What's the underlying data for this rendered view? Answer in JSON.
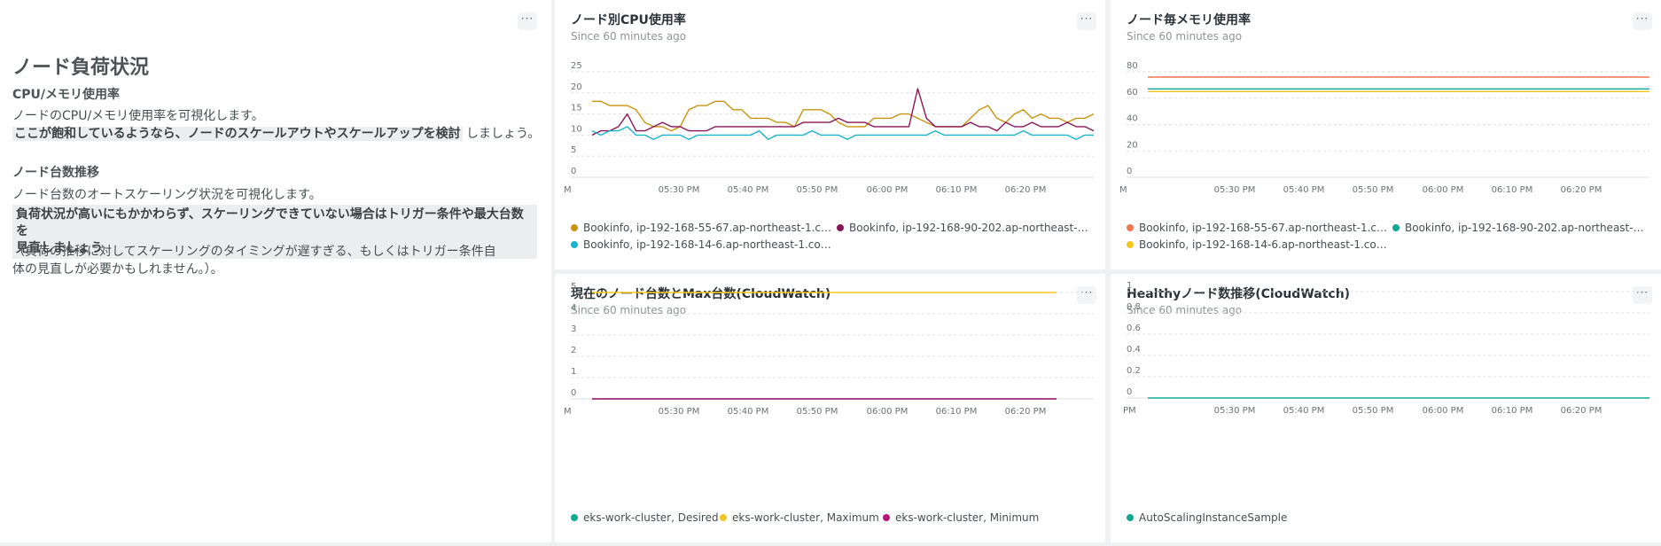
{
  "markdown": {
    "heading": "ノード負荷状況",
    "sections": [
      {
        "subheading": "CPU/メモリ使用率",
        "line1": "ノードのCPU/メモリ使用率を可視化します。",
        "highlight": "ここが飽和しているようなら、ノードのスケールアウトやスケールアップを検討",
        "tail": " しましょう。"
      },
      {
        "subheading": "ノード台数推移",
        "line1": "ノード台数のオートスケーリング状況を可視化します。",
        "highlight_l1": "負荷状況が高いにもかかわらず、スケーリングできていない場合はトリガー条件や最大台数を",
        "highlight_l2": "見直しましょう",
        "note_l1": "（負荷の推移に対してスケーリングのタイミングが遅すぎる、もしくはトリガー条件自",
        "note_l2": "体の見直しが必要かもしれません。）。"
      }
    ],
    "menu": "···"
  },
  "widgets": [
    {
      "title": "ノード別CPU使用率",
      "since": "Since 60 minutes ago",
      "menu": "···",
      "legend": [
        {
          "label": "Bookinfo, ip-192-168-55-67.ap-northeast-1.co...",
          "color": "#c9920f"
        },
        {
          "label": "Bookinfo, ip-192-168-90-202.ap-northeast-1.c...",
          "color": "#8a1457"
        },
        {
          "label": "Bookinfo, ip-192-168-14-6.ap-northeast-1.com...",
          "color": "#18b3cc"
        }
      ]
    },
    {
      "title": "ノード毎メモリ使用率",
      "since": "Since 60 minutes ago",
      "menu": "···",
      "legend": [
        {
          "label": "Bookinfo, ip-192-168-55-67.ap-northeast-1.co...",
          "color": "#f3754f"
        },
        {
          "label": "Bookinfo, ip-192-168-90-202.ap-northeast-1.c...",
          "color": "#11a893"
        },
        {
          "label": "Bookinfo, ip-192-168-14-6.ap-northeast-1.com...",
          "color": "#f5c51f"
        }
      ]
    },
    {
      "title": "現在のノード台数とMax台数(CloudWatch)",
      "since": "Since 60 minutes ago",
      "menu": "···",
      "legend": [
        {
          "label": "eks-work-cluster, Desired",
          "color": "#11a893"
        },
        {
          "label": "eks-work-cluster, Maximum",
          "color": "#f5c51f"
        },
        {
          "label": "eks-work-cluster, Minimum",
          "color": "#b5167a"
        }
      ]
    },
    {
      "title": "Healthyノード数推移(CloudWatch)",
      "since": "Since 60 minutes ago",
      "menu": "···",
      "legend": [
        {
          "label": "AutoScalingInstanceSample",
          "color": "#11a893"
        }
      ]
    }
  ],
  "chart_data": [
    {
      "type": "line",
      "title": "ノード別CPU使用率",
      "x_ticks": [
        "M",
        "05:30 PM",
        "05:40 PM",
        "05:50 PM",
        "06:00 PM",
        "06:10 PM",
        "06:20 PM"
      ],
      "y_ticks": [
        "0",
        "5",
        "10",
        "15",
        "20",
        "25"
      ],
      "ylim": [
        0,
        25
      ],
      "x_points": 58,
      "series": [
        {
          "name": "Bookinfo, ip-192-168-55-67.ap-northeast-1.co...",
          "color": "#c9920f",
          "values": [
            18,
            18,
            17,
            17,
            17,
            16,
            13,
            12,
            12,
            11,
            12,
            16,
            17,
            17,
            18,
            18,
            16,
            16,
            14,
            14,
            14,
            13,
            13,
            12,
            16,
            16,
            16,
            15,
            13,
            12,
            12,
            12,
            14,
            14,
            14,
            15,
            15,
            14,
            13,
            12,
            12,
            12,
            12,
            14,
            16,
            17,
            14,
            13,
            15,
            16,
            14,
            15,
            14,
            14,
            13,
            14,
            14,
            15
          ]
        },
        {
          "name": "Bookinfo, ip-192-168-90-202.ap-northeast-1.c...",
          "color": "#8a1457",
          "values": [
            10,
            11,
            11,
            12,
            15,
            11,
            11,
            12,
            13,
            12,
            12,
            11,
            11,
            11,
            12,
            12,
            12,
            12,
            12,
            12,
            12,
            12,
            12,
            12,
            13,
            13,
            13,
            13,
            14,
            13,
            13,
            13,
            12,
            12,
            12,
            12,
            12,
            21,
            14,
            12,
            12,
            12,
            12,
            13,
            12,
            12,
            11,
            13,
            12,
            12,
            13,
            12,
            12,
            12,
            13,
            12,
            12,
            11
          ]
        },
        {
          "name": "Bookinfo, ip-192-168-14-6.ap-northeast-1.com...",
          "color": "#18b3cc",
          "values": [
            11,
            10,
            11,
            11,
            12,
            10,
            10,
            9,
            10,
            10,
            10,
            9,
            10,
            10,
            10,
            10,
            10,
            10,
            10,
            11,
            9,
            10,
            10,
            10,
            10,
            11,
            10,
            10,
            10,
            9,
            10,
            10,
            10,
            10,
            10,
            10,
            10,
            10,
            10,
            11,
            10,
            10,
            10,
            10,
            10,
            10,
            10,
            10,
            10,
            11,
            10,
            10,
            10,
            10,
            10,
            9,
            10,
            10
          ]
        }
      ]
    },
    {
      "type": "line",
      "title": "ノード毎メモリ使用率",
      "x_ticks": [
        "M",
        "05:30 PM",
        "05:40 PM",
        "05:50 PM",
        "06:00 PM",
        "06:10 PM",
        "06:20 PM"
      ],
      "y_ticks": [
        "0",
        "20",
        "40",
        "60",
        "80"
      ],
      "ylim": [
        0,
        80
      ],
      "x_points": 2,
      "series": [
        {
          "name": "Bookinfo, ip-192-168-55-67.ap-northeast-1.co...",
          "color": "#f3754f",
          "values": [
            76,
            76
          ]
        },
        {
          "name": "Bookinfo, ip-192-168-90-202.ap-northeast-1.c...",
          "color": "#11a893",
          "values": [
            67,
            67
          ]
        },
        {
          "name": "Bookinfo, ip-192-168-14-6.ap-northeast-1.com...",
          "color": "#f5c51f",
          "values": [
            65,
            65
          ]
        }
      ]
    },
    {
      "type": "line",
      "title": "現在のノード台数とMax台数(CloudWatch)",
      "x_ticks": [
        "M",
        "05:30 PM",
        "05:40 PM",
        "05:50 PM",
        "06:00 PM",
        "06:10 PM",
        "06:20 PM"
      ],
      "y_ticks": [
        "0",
        "1",
        "2",
        "3",
        "4",
        "5"
      ],
      "ylim": [
        0,
        5
      ],
      "x_points": 2,
      "series": [
        {
          "name": "eks-work-cluster, Desired",
          "color": "#11a893",
          "values": [
            0,
            0
          ]
        },
        {
          "name": "eks-work-cluster, Maximum",
          "color": "#f5c51f",
          "values": [
            5,
            5
          ]
        },
        {
          "name": "eks-work-cluster, Minimum",
          "color": "#b5167a",
          "values": [
            0,
            0
          ]
        }
      ]
    },
    {
      "type": "line",
      "title": "Healthyノード数推移(CloudWatch)",
      "x_ticks": [
        "PM",
        "05:30 PM",
        "05:40 PM",
        "05:50 PM",
        "06:00 PM",
        "06:10 PM",
        "06:20 PM"
      ],
      "y_ticks": [
        "0",
        "0.2",
        "0.4",
        "0.6",
        "0.8",
        "1"
      ],
      "ylim": [
        0,
        1
      ],
      "x_points": 2,
      "series": [
        {
          "name": "AutoScalingInstanceSample",
          "color": "#11a893",
          "values": [
            0,
            0
          ]
        }
      ]
    }
  ]
}
